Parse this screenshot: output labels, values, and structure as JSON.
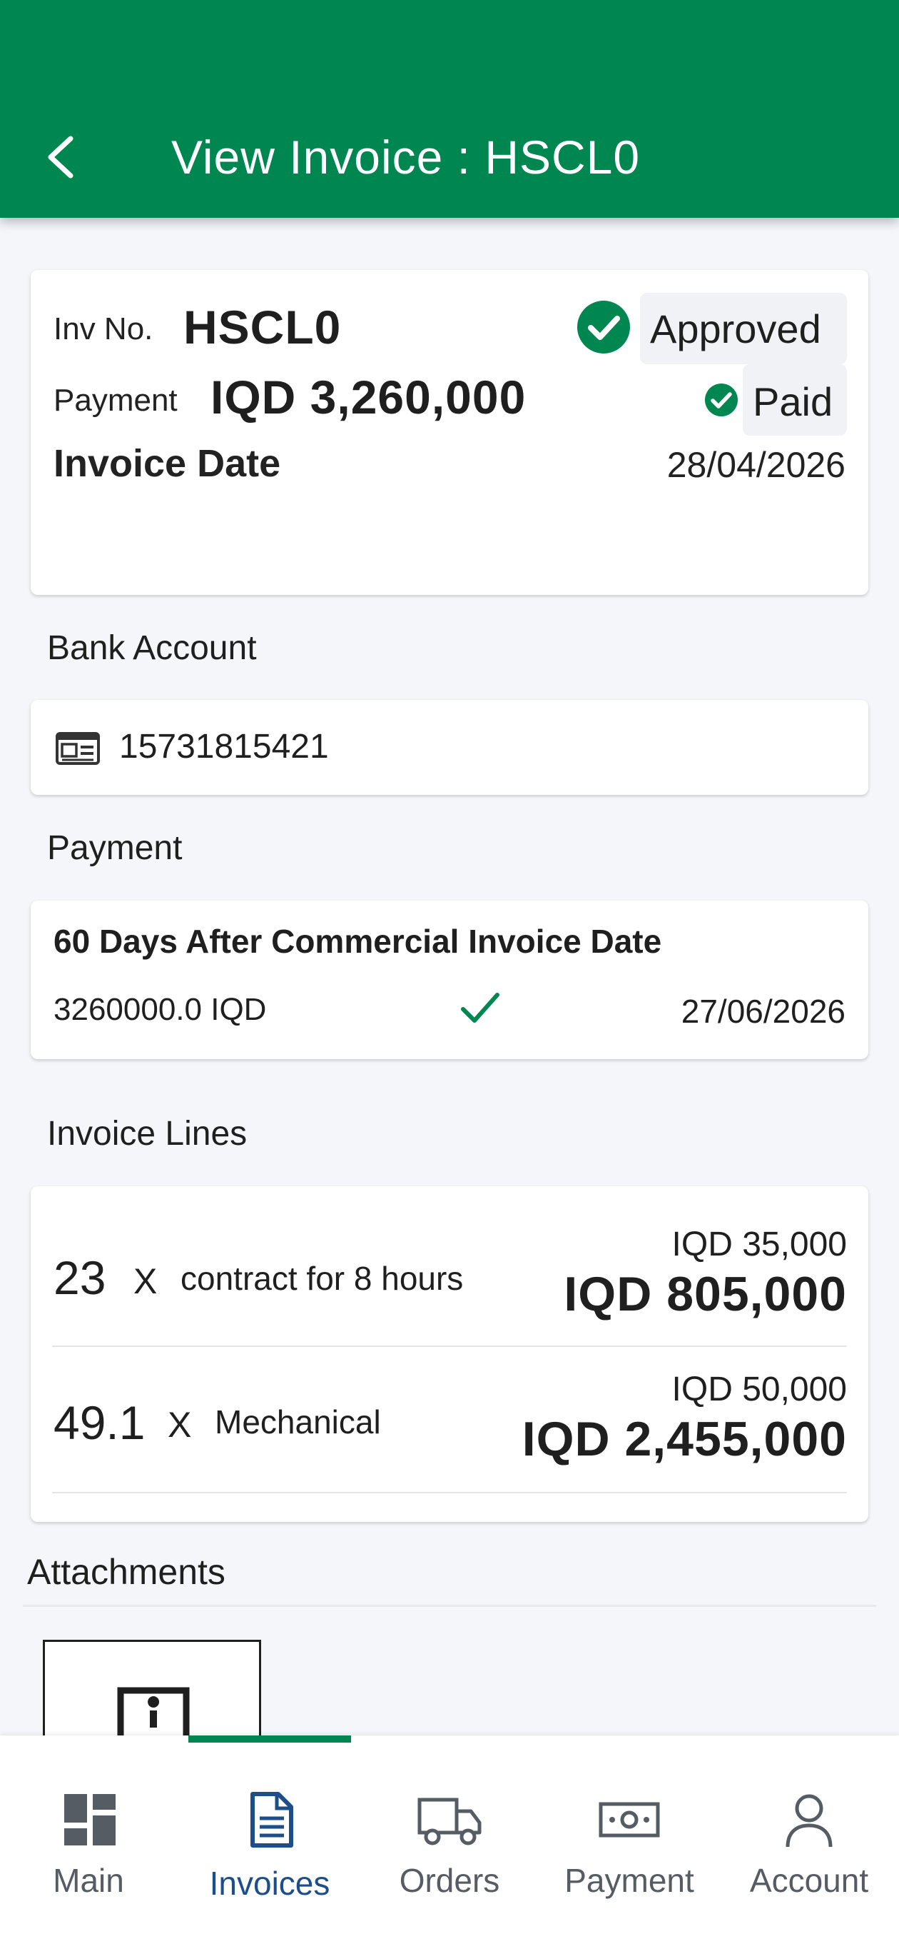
{
  "header": {
    "title": "View Invoice : HSCL0"
  },
  "invoice": {
    "inv_no_label": "Inv No.",
    "inv_no": "HSCL0",
    "status": "Approved",
    "payment_label": "Payment",
    "payment_amount": "IQD 3,260,000",
    "payment_status": "Paid",
    "date_label": "Invoice Date",
    "date_value": "28/04/2026"
  },
  "bank": {
    "section_label": "Bank Account",
    "account_number": "15731815421"
  },
  "payment": {
    "section_label": "Payment",
    "term": "60 Days After Commercial Invoice Date",
    "amount": "3260000.0 IQD",
    "due_date": "27/06/2026"
  },
  "lines": {
    "section_label": "Invoice Lines",
    "items": [
      {
        "qty": "23",
        "x": "X",
        "description": "contract for 8 hours",
        "unit_price": "IQD 35,000",
        "total": "IQD 805,000"
      },
      {
        "qty": "49.1",
        "x": "X",
        "description": "Mechanical",
        "unit_price": "IQD 50,000",
        "total": "IQD 2,455,000"
      }
    ]
  },
  "attachments": {
    "section_label": "Attachments"
  },
  "nav": {
    "items": [
      {
        "label": "Main",
        "icon": "dashboard-icon"
      },
      {
        "label": "Invoices",
        "icon": "document-icon"
      },
      {
        "label": "Orders",
        "icon": "truck-icon"
      },
      {
        "label": "Payment",
        "icon": "banknote-icon"
      },
      {
        "label": "Account",
        "icon": "person-icon"
      }
    ]
  },
  "colors": {
    "brand_green": "#008751",
    "active_nav": "#1d4e89",
    "background": "#f4f6fa"
  }
}
